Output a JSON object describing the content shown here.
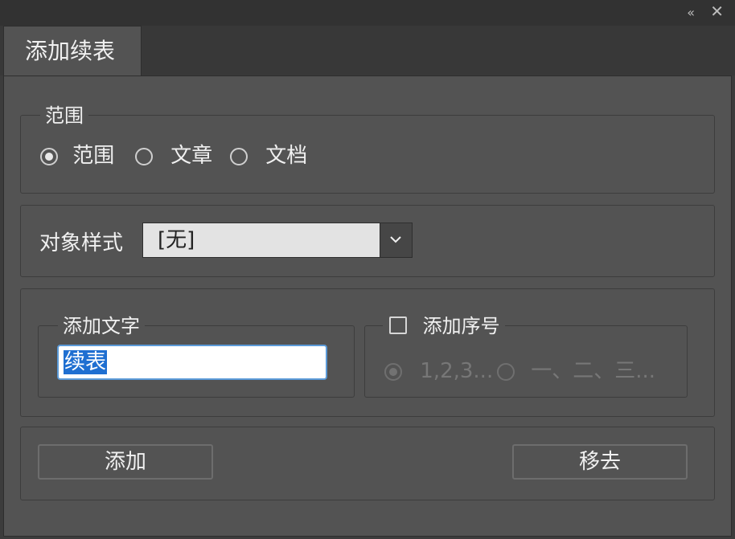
{
  "titlebar": {
    "collapse_icon": "«",
    "close_icon": "✕"
  },
  "tab": {
    "label": "添加续表"
  },
  "scope": {
    "legend": "范围",
    "options": [
      {
        "label": "范围",
        "checked": true
      },
      {
        "label": "文章",
        "checked": false
      },
      {
        "label": "文档",
        "checked": false
      }
    ]
  },
  "object_style": {
    "label": "对象样式",
    "value": "[无]"
  },
  "add_text": {
    "legend": "添加文字",
    "value": "续表"
  },
  "add_number": {
    "legend": "添加序号",
    "checked": false,
    "options": [
      {
        "label": "1,2,3...",
        "checked": true,
        "disabled": true
      },
      {
        "label": "一、二、三...",
        "checked": false,
        "disabled": true
      }
    ]
  },
  "buttons": {
    "add": "添加",
    "remove": "移去"
  }
}
